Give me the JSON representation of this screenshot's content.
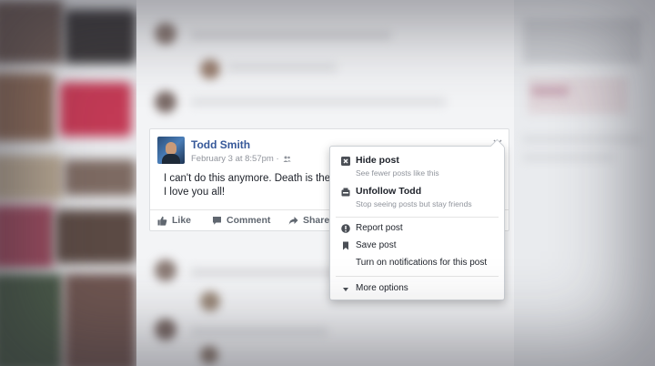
{
  "post": {
    "author": "Todd Smith",
    "timestamp": "February 3 at 8:57pm ·",
    "audience_icon": "friends-icon",
    "text_line1": "I can't do this anymore.  Death is the c",
    "text_line2": "I love you all!",
    "actions": {
      "like": "Like",
      "comment": "Comment",
      "share": "Share"
    }
  },
  "menu": {
    "hide": {
      "title": "Hide post",
      "subtitle": "See fewer posts like this"
    },
    "unfollow": {
      "title": "Unfollow Todd",
      "subtitle": "Stop seeing posts but stay friends"
    },
    "report": "Report post",
    "save": "Save post",
    "notifications": "Turn on notifications for this post",
    "more": "More options"
  },
  "colors": {
    "link": "#365899",
    "meta": "#90949c",
    "text": "#1d2129"
  }
}
